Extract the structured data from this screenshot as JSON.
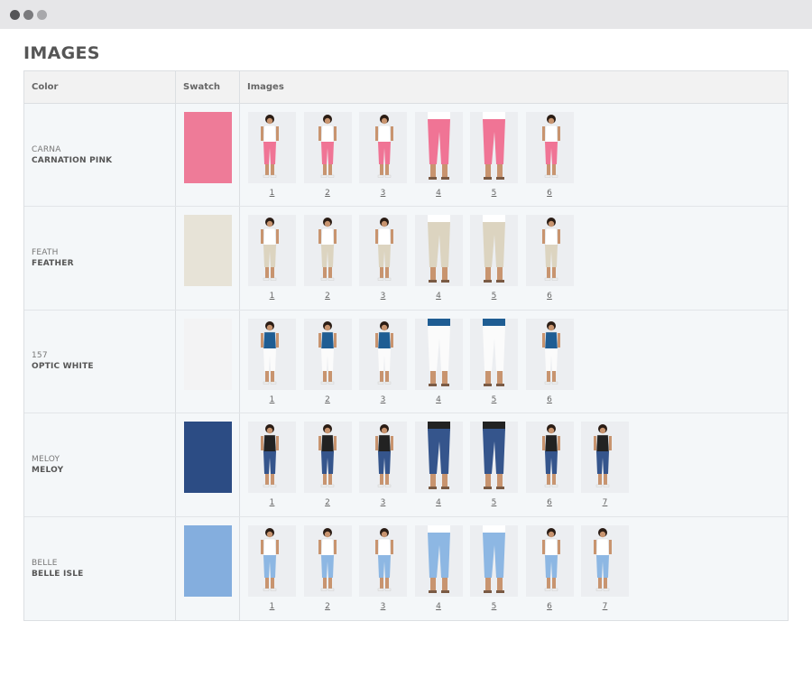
{
  "page": {
    "title": "IMAGES"
  },
  "table": {
    "headers": {
      "color": "Color",
      "swatch": "Swatch",
      "images": "Images"
    },
    "rows": [
      {
        "code": "CARNA",
        "name": "CARNATION PINK",
        "swatch_color": "#ee7b98",
        "pant_color": "#f07495",
        "top_color": "#ffffff",
        "images": [
          "1",
          "2",
          "3",
          "4",
          "5",
          "6"
        ]
      },
      {
        "code": "FEATH",
        "name": "FEATHER",
        "swatch_color": "#e7e3d7",
        "pant_color": "#dcd4c0",
        "top_color": "#ffffff",
        "images": [
          "1",
          "2",
          "3",
          "4",
          "5",
          "6"
        ]
      },
      {
        "code": "157",
        "name": "OPTIC WHITE",
        "swatch_color": "#f3f3f4",
        "pant_color": "#fbfbfb",
        "top_color": "#1f5d93",
        "images": [
          "1",
          "2",
          "3",
          "4",
          "5",
          "6"
        ]
      },
      {
        "code": "MELOY",
        "name": "MELOY",
        "swatch_color": "#2c4c84",
        "pant_color": "#35558c",
        "top_color": "#222222",
        "images": [
          "1",
          "2",
          "3",
          "4",
          "5",
          "6",
          "7"
        ]
      },
      {
        "code": "BELLE",
        "name": "BELLE ISLE",
        "swatch_color": "#84aede",
        "pant_color": "#8db7e3",
        "top_color": "#ffffff",
        "images": [
          "1",
          "2",
          "3",
          "4",
          "5",
          "6",
          "7"
        ]
      }
    ]
  }
}
